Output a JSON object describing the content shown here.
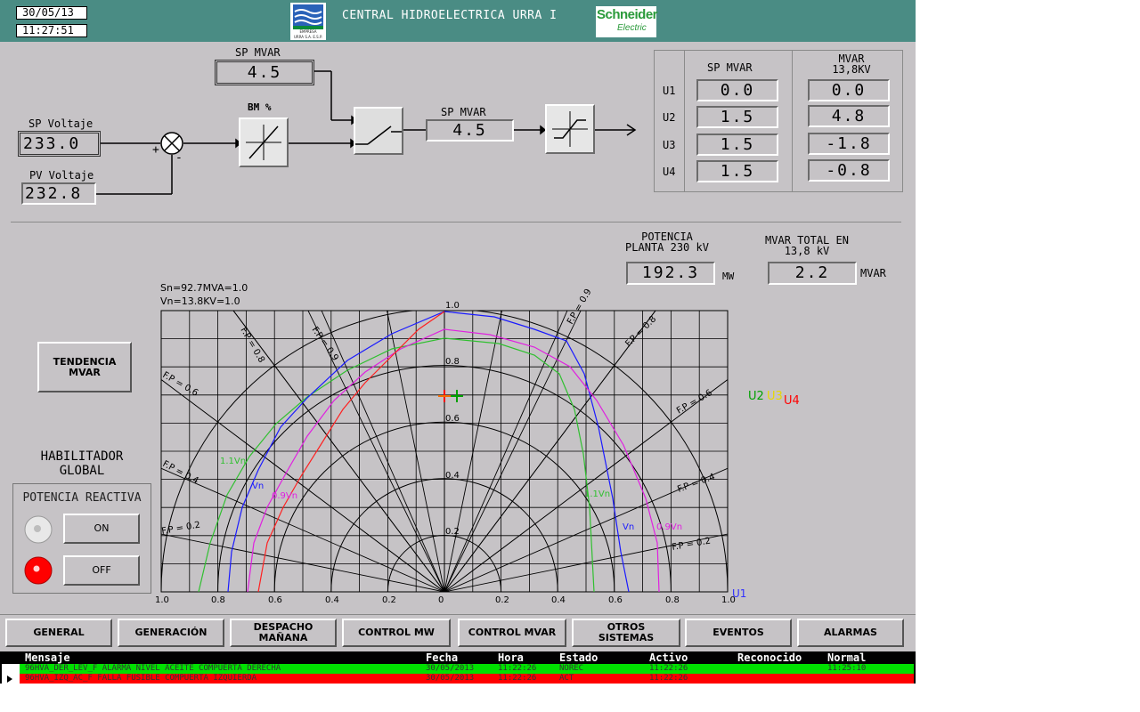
{
  "header": {
    "date": "30/05/13",
    "time": "11:27:51",
    "title": "CENTRAL HIDROELECTRICA URRA I",
    "logo_left": {
      "line1": "EMPRESA",
      "line2": "URRA S.A. E.S.P."
    },
    "logo_right": {
      "line1": "Schneider",
      "line2": "Electric"
    }
  },
  "control": {
    "sp_mvar_label": "SP MVAR",
    "sp_mvar_value": "4.5",
    "sp_voltaje_label": "SP Voltaje",
    "sp_voltaje_value": "233.0",
    "pv_voltaje_label": "PV Voltaje",
    "pv_voltaje_value": "232.8",
    "bm_label": "BM %",
    "sp_mvar2_label": "SP MVAR",
    "sp_mvar2_value": "4.5",
    "plus": "+",
    "minus": "-"
  },
  "unit_table": {
    "col1_header": "SP MVAR",
    "col2_header_line1": "MVAR",
    "col2_header_line2": "13,8KV",
    "rows": [
      {
        "unit": "U1",
        "sp": "0.0",
        "mvar": "0.0"
      },
      {
        "unit": "U2",
        "sp": "1.5",
        "mvar": "4.8"
      },
      {
        "unit": "U3",
        "sp": "1.5",
        "mvar": "-1.8"
      },
      {
        "unit": "U4",
        "sp": "1.5",
        "mvar": "-0.8"
      }
    ]
  },
  "totals": {
    "potencia_label_line1": "POTENCIA",
    "potencia_label_line2": "PLANTA 230 kV",
    "potencia_value": "192.3",
    "potencia_unit": "MW",
    "mvar_total_line1": "MVAR TOTAL EN",
    "mvar_total_line2": "13,8 kV",
    "mvar_total_value": "2.2",
    "mvar_total_unit": "MVAR"
  },
  "diagram": {
    "sn_note": "Sn=92.7MVA=1.0",
    "vn_note": "Vn=13.8KV=1.0",
    "x_ticks": [
      "1.0",
      "0.8",
      "0.6",
      "0.4",
      "0.2",
      "0",
      "0.2",
      "0.4",
      "0.6",
      "0.8",
      "1.0"
    ],
    "y_ticks": [
      "1.0",
      "0.8",
      "0.6",
      "0.4",
      "0.2"
    ],
    "fp_labels": [
      "F.P = 0.8",
      "F.P = 0.9",
      "F.P = 0.6",
      "F.P = 0.4",
      "F.P = 0.2",
      "F.P = 0.9",
      "F.P = 0.8",
      "F.P = 0.6",
      "F.P = 0.4",
      "F.P = 0.2"
    ],
    "curve_labels": {
      "v11": "1.1Vn",
      "vn": "Vn",
      "v09": "0.9Vn",
      "v11r": "1.1Vn",
      "vnr": "Vn",
      "v09r": "0.9Vn"
    },
    "legend": {
      "u2": "U2",
      "u3": "U3",
      "u4": "U4",
      "u1": "U1"
    },
    "colors": {
      "u1": "#3030ff",
      "u2": "#00a000",
      "u3": "#e8d800",
      "u4": "#ff0000",
      "v11": "#30c030",
      "vn": "#1a1aff",
      "v09": "#e020e0",
      "limit": "#ff2020"
    }
  },
  "left_panel": {
    "tendencia_line1": "TENDENCIA",
    "tendencia_line2": "MVAR",
    "habilitador_line1": "HABILITADOR",
    "habilitador_line2": "GLOBAL",
    "potencia_reactiva": "POTENCIA REACTIVA",
    "on_label": "ON",
    "off_label": "OFF"
  },
  "nav": [
    {
      "line1": "GENERAL",
      "line2": ""
    },
    {
      "line1": "GENERACIÓN",
      "line2": ""
    },
    {
      "line1": "DESPACHO",
      "line2": "MAÑANA"
    },
    {
      "line1": "CONTROL MW",
      "line2": ""
    },
    {
      "line1": "CONTROL MVAR",
      "line2": ""
    },
    {
      "line1": "OTROS",
      "line2": "SISTEMAS"
    },
    {
      "line1": "EVENTOS",
      "line2": ""
    },
    {
      "line1": "ALARMAS",
      "line2": ""
    }
  ],
  "alarm_table": {
    "headers": {
      "mensaje": "Mensaje",
      "fecha": "Fecha",
      "hora": "Hora",
      "estado": "Estado",
      "activo": "Activo",
      "reconocido": "Reconocido",
      "normal": "Normal"
    },
    "rows": [
      {
        "mensaje": "96HVA_DER_LEV_F ALARMA NIVEL ACEITE COMPUERTA DERECHA",
        "fecha": "30/05/2013",
        "hora": "11:22:26",
        "estado": "NOREC",
        "activo": "11:22:26",
        "reconocido": "",
        "normal": "11:25:10",
        "color": "#00e000"
      },
      {
        "mensaje": "96HVA_IZQ_AC_F FALLA FUSIBLE COMPUERTA IZQUIERDA",
        "fecha": "30/05/2013",
        "hora": "11:22:26",
        "estado": "ACT",
        "activo": "11:22:26",
        "reconocido": "",
        "normal": "",
        "color": "#ff0000"
      }
    ]
  }
}
